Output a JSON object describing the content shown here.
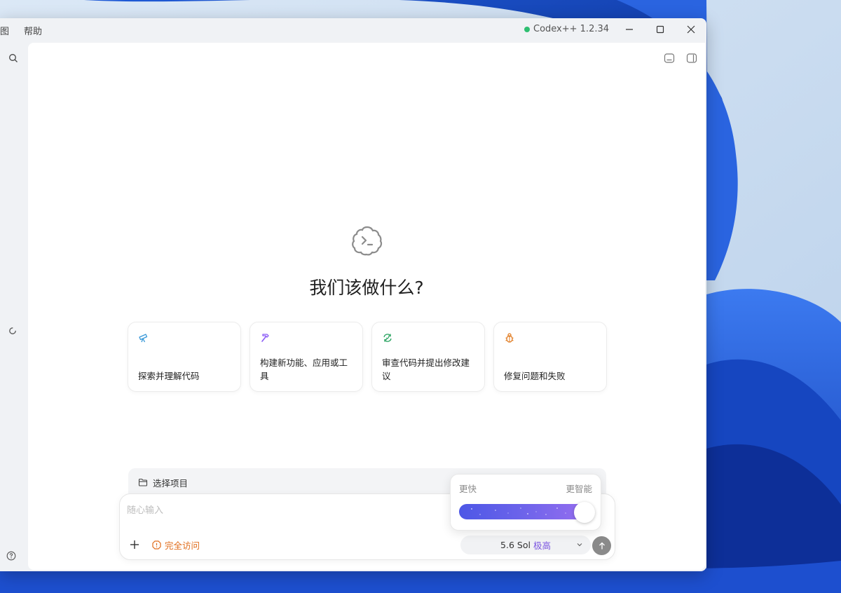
{
  "titlebar": {
    "menu_partial": "图",
    "menu_help": "帮助",
    "app_title": "Codex++ 1.2.34",
    "status_color": "#2fbf71"
  },
  "icons": {
    "search": "search-icon",
    "loading": "loading-ring-icon",
    "help": "help-circle-icon",
    "terminal_toggle": "terminal-panel-icon",
    "sidebar_toggle": "sidebar-panel-icon",
    "logo": "cloud-terminal-logo"
  },
  "main": {
    "title": "我们该做什么?"
  },
  "cards": [
    {
      "label": "探索并理解代码",
      "icon": "telescope-icon",
      "color": "#3b9ad9"
    },
    {
      "label": "构建新功能、应用或工具",
      "icon": "hammer-icon",
      "color": "#8b5cf6"
    },
    {
      "label": "审查代码并提出修改建议",
      "icon": "refresh-check-icon",
      "color": "#22a05b"
    },
    {
      "label": "修复问题和失败",
      "icon": "bug-icon",
      "color": "#e07a1f"
    }
  ],
  "composer": {
    "project_label": "选择项目",
    "placeholder": "随心输入",
    "access_label": "完全访问",
    "access_color": "#e06c1a",
    "model_name": "5.6 Sol",
    "model_level": "极高",
    "model_level_color": "#7b55e0"
  },
  "speed_popup": {
    "left_label": "更快",
    "right_label": "更智能",
    "value_fraction": 1.0
  }
}
